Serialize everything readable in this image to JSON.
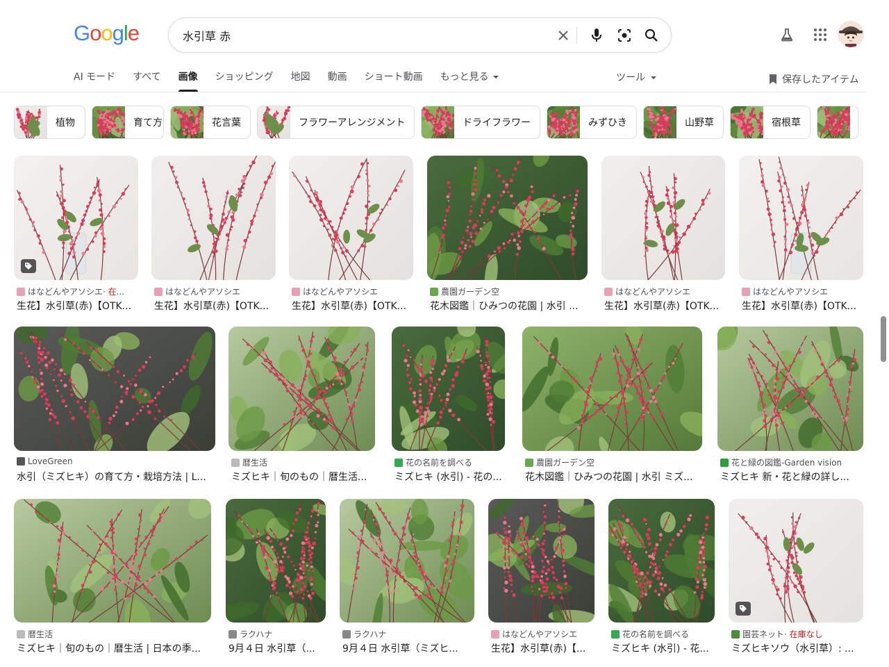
{
  "logo": [
    "G",
    "o",
    "o",
    "g",
    "l",
    "e"
  ],
  "logo_colors": [
    "#4285F4",
    "#EA4335",
    "#FBBC05",
    "#4285F4",
    "#34A853",
    "#EA4335"
  ],
  "search": {
    "query": "水引草 赤"
  },
  "tabs": [
    {
      "label": "AI モード",
      "active": false
    },
    {
      "label": "すべて",
      "active": false
    },
    {
      "label": "画像",
      "active": true
    },
    {
      "label": "ショッピング",
      "active": false
    },
    {
      "label": "地図",
      "active": false
    },
    {
      "label": "動画",
      "active": false
    },
    {
      "label": "ショート動画",
      "active": false
    },
    {
      "label": "もっと見る",
      "active": false,
      "caret": true
    }
  ],
  "tools_label": "ツール",
  "saved_label": "保存したアイテム",
  "chips": [
    {
      "label": "植物"
    },
    {
      "label": "育て方"
    },
    {
      "label": "花言葉"
    },
    {
      "label": "フラワーアレンジメント"
    },
    {
      "label": "ドライフラワー"
    },
    {
      "label": "みずひき"
    },
    {
      "label": "山野草"
    },
    {
      "label": "宿根草"
    }
  ],
  "results": [
    {
      "source": "はなどんやアソシエ",
      "stock": "· 在...",
      "title": "生花】水引草(赤)【OTK...",
      "tag": true,
      "fav": "#e8a0b4"
    },
    {
      "source": "はなどんやアソシエ",
      "stock": "",
      "title": "生花】水引草(赤)【OTK...",
      "tag": false,
      "fav": "#e8a0b4"
    },
    {
      "source": "はなどんやアソシエ",
      "stock": "",
      "title": "生花】水引草(赤)【OTK...",
      "tag": false,
      "fav": "#e8a0b4"
    },
    {
      "source": "農園ガーデン空",
      "stock": "",
      "title": "花木図鑑｜ひみつの花園 | 水引 ...",
      "tag": false,
      "fav": "#6aa84f"
    },
    {
      "source": "はなどんやアソシエ",
      "stock": "",
      "title": "生花】水引草(赤)【OTK...",
      "tag": false,
      "fav": "#e8a0b4"
    },
    {
      "source": "はなどんやアソシエ",
      "stock": "",
      "title": "生花】水引草(赤)【OTK...",
      "tag": false,
      "fav": "#e8a0b4"
    },
    {
      "source": "LoveGreen",
      "stock": "",
      "title": "水引（ミズヒキ）の育て方・栽培方法 | L...",
      "tag": false,
      "fav": "#555555"
    },
    {
      "source": "暦生活",
      "stock": "",
      "title": "ミズヒキ｜旬のもの｜暦生活...",
      "tag": false,
      "fav": "#bbbbbb"
    },
    {
      "source": "花の名前を調べる",
      "stock": "",
      "title": "ミズヒキ (水引) - 花の...",
      "tag": false,
      "fav": "#34a853"
    },
    {
      "source": "農園ガーデン空",
      "stock": "",
      "title": "花木図鑑｜ひみつの花園 | 水引 ミズ...",
      "tag": false,
      "fav": "#6aa84f"
    },
    {
      "source": "花と緑の図鑑-Garden vision",
      "stock": "",
      "title": "ミズヒキ 新・花と緑の詳し...",
      "tag": false,
      "fav": "#2e9e3e"
    },
    {
      "source": "暦生活",
      "stock": "",
      "title": "ミズヒキ｜旬のもの｜暦生活 | 日本の季...",
      "tag": false,
      "fav": "#bbbbbb"
    },
    {
      "source": "ラクハナ",
      "stock": "",
      "title": "9月４日 水引草（...",
      "tag": false,
      "fav": "#888888"
    },
    {
      "source": "ラクハナ",
      "stock": "",
      "title": "9月４日 水引草（ミズヒ...",
      "tag": false,
      "fav": "#888888"
    },
    {
      "source": "はなどんやアソシエ",
      "stock": "",
      "title": "生花】水引草(赤)【...",
      "tag": false,
      "fav": "#e8a0b4"
    },
    {
      "source": "花の名前を調べる",
      "stock": "",
      "title": "ミズヒキ (水引) - 花...",
      "tag": false,
      "fav": "#34a853"
    },
    {
      "source": "園芸ネット",
      "stock": "· 在庫なし",
      "title": "ミズヒキソウ（水引草）: ...",
      "tag": true,
      "fav": "#4a8c3a"
    }
  ]
}
